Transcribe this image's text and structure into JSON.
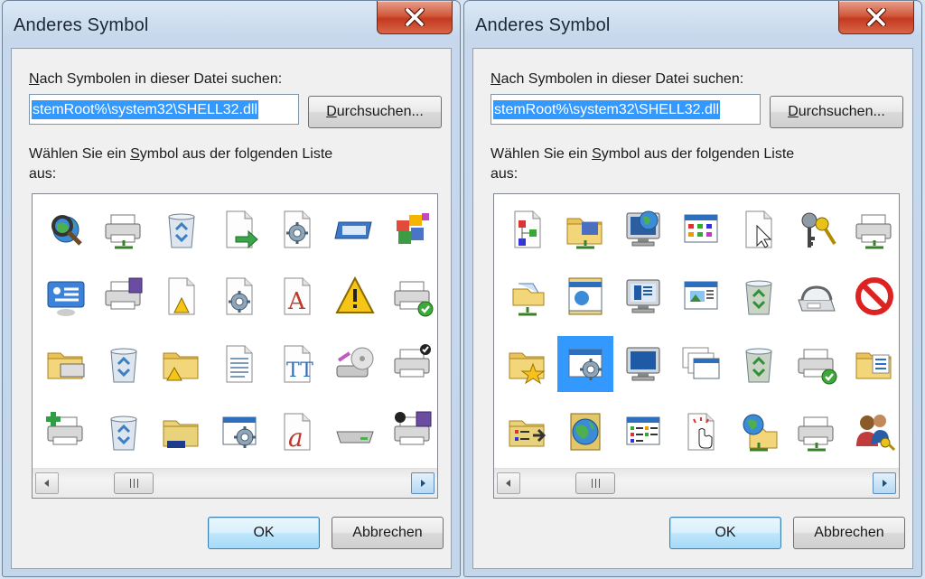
{
  "dialogs": [
    {
      "title": "Anderes Symbol",
      "search_label": {
        "pre": "",
        "accel": "N",
        "post": "ach Symbolen in dieser Datei suchen:"
      },
      "path_value": "stemRoot%\\system32\\SHELL32.dll",
      "browse": {
        "accel": "D",
        "post": "urchsuchen..."
      },
      "list_label_line1": {
        "pre": "Wählen Sie ein ",
        "accel": "S",
        "post": "ymbol aus der folgenden Liste"
      },
      "list_label_line2": "aus:",
      "ok_label": "OK",
      "cancel_label": "Abbrechen",
      "icons": [
        "search-globe-icon",
        "printer-network-icon",
        "recycle-bin-icon",
        "file-arrow-icon",
        "gear-document-icon",
        "window-blue-icon",
        "programs-icon",
        "control-panel-icon",
        "printer-fax-icon",
        "warning-document-icon",
        "settings-document-icon",
        "font-a-icon",
        "warning-icon",
        "printer-check-icon",
        "printer-folder-icon",
        "recycle-bin-icon",
        "warning-folder-icon",
        "text-document-icon",
        "font-tt-icon",
        "disk-drive-icon",
        "printer-default-icon",
        "add-printer-icon",
        "recycle-bin-icon",
        "folder-open-icon",
        "gear-window-icon",
        "font-italic-a-icon",
        "drive-icon",
        "printer-disk-icon"
      ],
      "selected_index": -1
    },
    {
      "title": "Anderes Symbol",
      "search_label": {
        "pre": "",
        "accel": "N",
        "post": "ach Symbolen in dieser Datei suchen:"
      },
      "path_value": "stemRoot%\\system32\\SHELL32.dll",
      "browse": {
        "accel": "D",
        "post": "urchsuchen..."
      },
      "list_label_line1": {
        "pre": "Wählen Sie ein ",
        "accel": "S",
        "post": "ymbol aus der folgenden Liste"
      },
      "list_label_line2": "aus:",
      "ok_label": "OK",
      "cancel_label": "Abbrechen",
      "icons": [
        "hierarchy-icon",
        "network-folder-icon",
        "network-globe-icon",
        "icons-view-icon",
        "cursor-document-icon",
        "keys-icon",
        "printer-network-icon",
        "network-share-icon",
        "window-globe-icon",
        "monitor-window-icon",
        "picture-window-icon",
        "recycle-bin-full-icon",
        "fax-phone-icon",
        "no-entry-icon",
        "favorites-folder-icon",
        "gear-window-icon",
        "monitor-blue-icon",
        "windows-stack-icon",
        "recycle-bin-full-icon",
        "printer-check-icon",
        "checklist-folder-icon",
        "folder-list-icon",
        "globe-book-icon",
        "list-view-icon",
        "hand-cursor-icon",
        "globe-network-icon",
        "printer-network-icon",
        "users-key-icon"
      ],
      "selected_index": 15
    }
  ],
  "colors": {
    "selection": "#3399ff",
    "close_button": "#c43a1f",
    "title_text": "#1d2733"
  }
}
